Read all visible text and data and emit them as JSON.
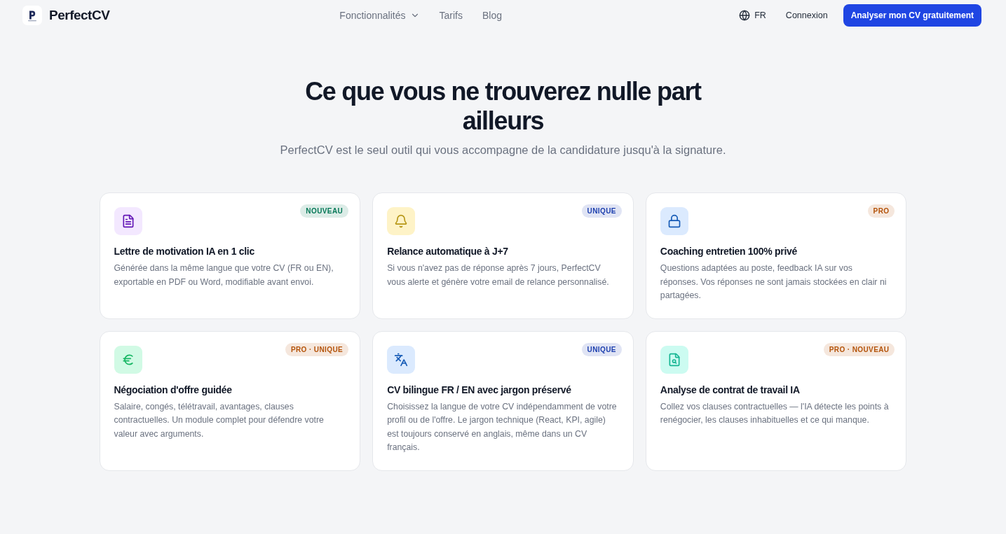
{
  "header": {
    "brand": "PerfectCV",
    "nav": [
      {
        "label": "Fonctionnalités",
        "dropdown": true
      },
      {
        "label": "Tarifs",
        "dropdown": false
      },
      {
        "label": "Blog",
        "dropdown": false
      }
    ],
    "language": "FR",
    "login": "Connexion",
    "cta": "Analyser mon CV gratuitement"
  },
  "section": {
    "title": "Ce que vous ne trouverez nulle part ailleurs",
    "subtitle": "PerfectCV est le seul outil qui vous accompagne de la candidature jusqu'à la signature."
  },
  "cards": [
    {
      "kind": "document",
      "color": "#f3e8ff",
      "badge": {
        "text": "NOUVEAU",
        "color": "#047857"
      },
      "title": "Lettre de motivation IA en 1 clic",
      "description": "Générée dans la même langue que votre CV (FR ou EN), exportable en PDF ou Word, modifiable avant envoi."
    },
    {
      "kind": "bell",
      "color": "#fef3c7",
      "badge": {
        "text": "UNIQUE",
        "color": "#1e40af"
      },
      "title": "Relance automatique à J+7",
      "description": "Si vous n'avez pas de réponse après 7 jours, PerfectCV vous alerte et génère votre email de relance personnalisé."
    },
    {
      "kind": "lock",
      "color": "#dbeafe",
      "badge": {
        "text": "PRO",
        "color": "#b45309"
      },
      "title": "Coaching entretien 100% privé",
      "description": "Questions adaptées au poste, feedback IA sur vos réponses. Vos réponses ne sont jamais stockées en clair ni partagées."
    },
    {
      "kind": "euro",
      "color": "#d1fae5",
      "badge": {
        "text": "PRO · UNIQUE",
        "color": "#b45309"
      },
      "title": "Négociation d'offre guidée",
      "description": "Salaire, congés, télétravail, avantages, clauses contractuelles. Un module complet pour défendre votre valeur avec arguments."
    },
    {
      "kind": "translate",
      "color": "#dbeafe",
      "badge": {
        "text": "UNIQUE",
        "color": "#1e40af"
      },
      "title": "CV bilingue FR / EN avec jargon préservé",
      "description": "Choisissez la langue de votre CV indépendamment de votre profil ou de l'offre. Le jargon technique (React, KPI, agile) est toujours conservé en anglais, même dans un CV français."
    },
    {
      "kind": "filesearch",
      "color": "#ccfbf1",
      "badge": {
        "text": "PRO · NOUVEAU",
        "color": "#b45309"
      },
      "title": "Analyse de contrat de travail IA",
      "description": "Collez vos clauses contractuelles — l'IA détecte les points à renégocier, les clauses inhabituelles et ce qui manque."
    }
  ]
}
